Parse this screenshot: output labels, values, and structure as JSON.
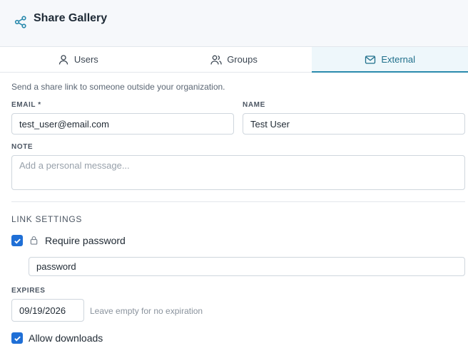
{
  "header": {
    "title": "Share Gallery",
    "icon": "share-icon"
  },
  "tabs": [
    {
      "label": "Users",
      "icon": "user-icon",
      "active": false
    },
    {
      "label": "Groups",
      "icon": "users-icon",
      "active": false
    },
    {
      "label": "External",
      "icon": "mail-icon",
      "active": true
    }
  ],
  "form": {
    "intro": "Send a share link to someone outside your organization.",
    "email": {
      "label": "EMAIL *",
      "value": "test_user@email.com"
    },
    "name": {
      "label": "NAME",
      "value": "Test User"
    },
    "note": {
      "label": "NOTE",
      "placeholder": "Add a personal message..."
    }
  },
  "link_settings": {
    "title": "LINK SETTINGS",
    "require_password": {
      "label": "Require password",
      "checked": true,
      "icon": "lock-icon"
    },
    "password_value": "password",
    "expires": {
      "label": "EXPIRES",
      "value": "09/19/2026",
      "hint": "Leave empty for no expiration"
    },
    "allow_downloads": {
      "label": "Allow downloads",
      "checked": true
    }
  },
  "colors": {
    "accent": "#2a8aad",
    "checkbox": "#1f6fd6",
    "header_bg": "#f6f8fb"
  }
}
